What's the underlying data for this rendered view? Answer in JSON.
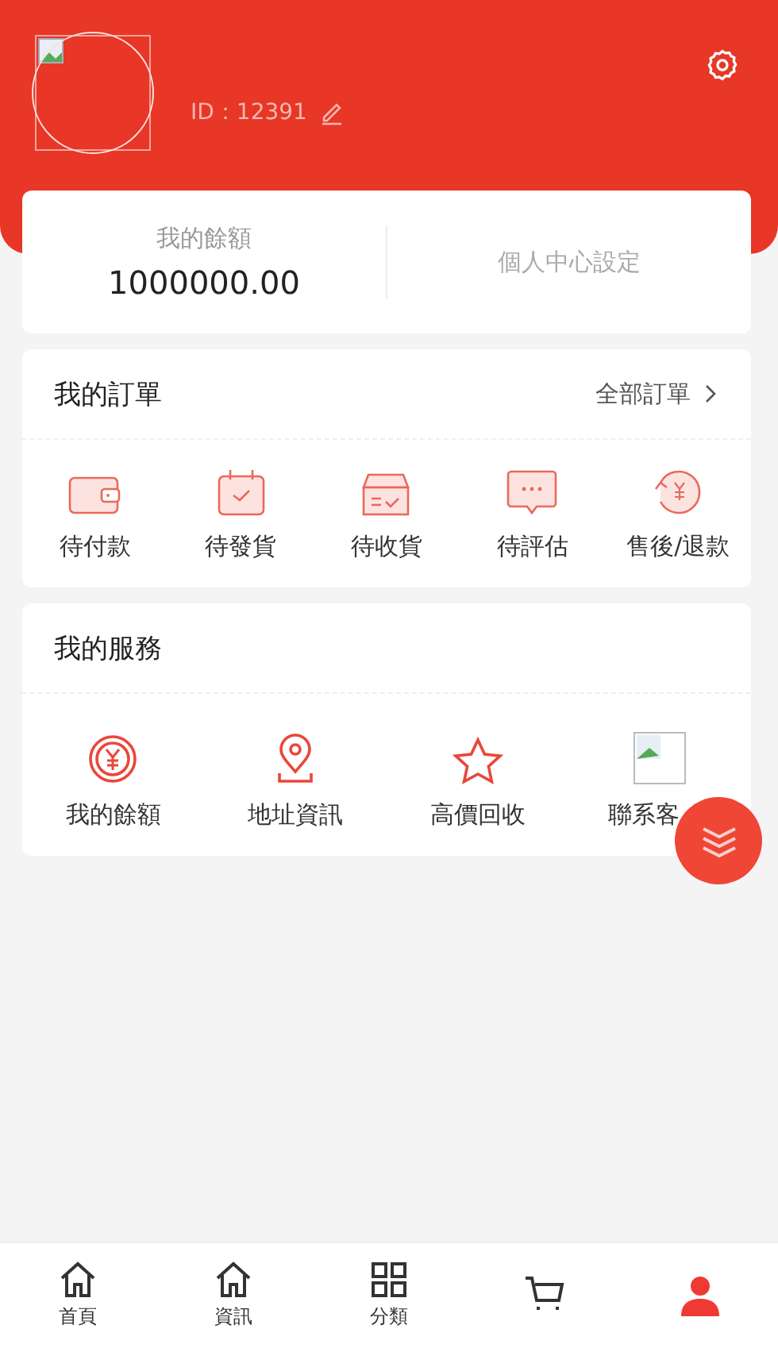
{
  "profile": {
    "id_label": "ID：",
    "id": "12391"
  },
  "balance": {
    "label": "我的餘額",
    "amount": "1000000.00"
  },
  "settings_link": "個人中心設定",
  "orders": {
    "title": "我的訂單",
    "all_link": "全部訂單",
    "items": [
      {
        "kind": "wallet",
        "label": "待付款"
      },
      {
        "kind": "calendar",
        "label": "待發貨"
      },
      {
        "kind": "box",
        "label": "待收貨"
      },
      {
        "kind": "chat",
        "label": "待評估"
      },
      {
        "kind": "refund",
        "label": "售後/退款"
      }
    ]
  },
  "services": {
    "title": "我的服務",
    "items": [
      {
        "kind": "coin",
        "label": "我的餘額"
      },
      {
        "kind": "pin",
        "label": "地址資訊"
      },
      {
        "kind": "star",
        "label": "高價回收"
      },
      {
        "kind": "broken",
        "label": "聯系客"
      }
    ]
  },
  "nav": [
    {
      "kind": "home",
      "label": "首頁",
      "selected": false
    },
    {
      "kind": "home",
      "label": "資訊",
      "selected": false
    },
    {
      "kind": "grid",
      "label": "分類",
      "selected": false
    },
    {
      "kind": "cart",
      "selected": false
    },
    {
      "kind": "user",
      "selected": true
    }
  ]
}
